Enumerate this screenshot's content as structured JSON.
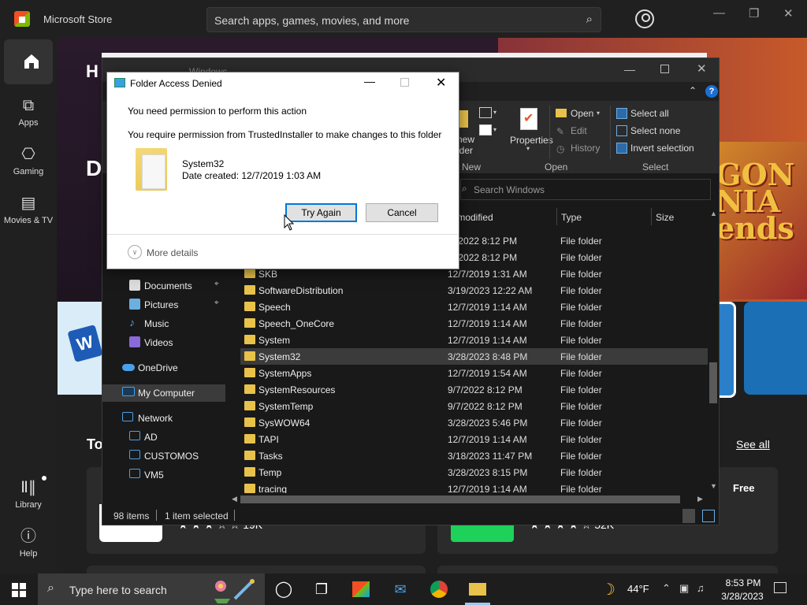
{
  "store": {
    "app_name": "Microsoft Store",
    "search_placeholder": "Search apps, games, movies, and more",
    "rail": [
      {
        "label": "Apps"
      },
      {
        "label": "Gaming"
      },
      {
        "label": "Movies & TV"
      },
      {
        "label": "Library"
      },
      {
        "label": "Help"
      }
    ],
    "hero_heading_partial": "H",
    "hero_sub_partial": "D",
    "game_logo_text": "GON\nNIA\nends",
    "section_partial": "To",
    "see_all": "See all",
    "card1_rating": "★ ★ ★ ☆ ☆  19K",
    "card2_rating": "★ ★ ★ ★ ☆  52K",
    "free_label": "Free",
    "word_tile_letter": "W"
  },
  "explorer": {
    "title": "Windows",
    "ribbon": {
      "new_folder_partial": "new\nlder",
      "properties": "Properties",
      "open": "Open",
      "edit": "Edit",
      "history": "History",
      "select_all": "Select all",
      "select_none": "Select none",
      "invert_selection": "Invert selection",
      "group_new": "New",
      "group_open": "Open",
      "group_select": "Select"
    },
    "search_placeholder": "Search Windows",
    "columns": {
      "date": "te modified",
      "type": "Type",
      "size": "Size"
    },
    "nav": [
      {
        "label": "Documents"
      },
      {
        "label": "Pictures"
      },
      {
        "label": "Music"
      },
      {
        "label": "Videos"
      },
      {
        "label": "OneDrive"
      },
      {
        "label": "My Computer"
      },
      {
        "label": "Network"
      },
      {
        "label": "AD"
      },
      {
        "label": "CUSTOMOS"
      },
      {
        "label": "VM5"
      }
    ],
    "files": [
      {
        "name": "",
        "date": "/7/2022 8:12 PM",
        "type": "File folder"
      },
      {
        "name": "",
        "date": "/7/2022 8:12 PM",
        "type": "File folder"
      },
      {
        "name": "SKB",
        "date": "12/7/2019 1:31 AM",
        "type": "File folder"
      },
      {
        "name": "SoftwareDistribution",
        "date": "3/19/2023 12:22 AM",
        "type": "File folder"
      },
      {
        "name": "Speech",
        "date": "12/7/2019 1:14 AM",
        "type": "File folder"
      },
      {
        "name": "Speech_OneCore",
        "date": "12/7/2019 1:14 AM",
        "type": "File folder"
      },
      {
        "name": "System",
        "date": "12/7/2019 1:14 AM",
        "type": "File folder"
      },
      {
        "name": "System32",
        "date": "3/28/2023 8:48 PM",
        "type": "File folder"
      },
      {
        "name": "SystemApps",
        "date": "12/7/2019 1:54 AM",
        "type": "File folder"
      },
      {
        "name": "SystemResources",
        "date": "9/7/2022 8:12 PM",
        "type": "File folder"
      },
      {
        "name": "SystemTemp",
        "date": "9/7/2022 8:12 PM",
        "type": "File folder"
      },
      {
        "name": "SysWOW64",
        "date": "3/28/2023 5:46 PM",
        "type": "File folder"
      },
      {
        "name": "TAPI",
        "date": "12/7/2019 1:14 AM",
        "type": "File folder"
      },
      {
        "name": "Tasks",
        "date": "3/18/2023 11:47 PM",
        "type": "File folder"
      },
      {
        "name": "Temp",
        "date": "3/28/2023 8:15 PM",
        "type": "File folder"
      },
      {
        "name": "tracing",
        "date": "12/7/2019 1:14 AM",
        "type": "File folder"
      }
    ],
    "status_items": "98 items",
    "status_selected": "1 item selected"
  },
  "dialog": {
    "title": "Folder Access Denied",
    "message1": "You need permission to perform this action",
    "message2": "You require permission from TrustedInstaller to make changes to this folder",
    "folder_name": "System32",
    "folder_date": "Date created: 12/7/2019 1:03 AM",
    "try_again": "Try Again",
    "cancel": "Cancel",
    "more_details": "More details"
  },
  "taskbar": {
    "search_placeholder": "Type here to search",
    "weather_temp": "44°F",
    "time": "8:53 PM",
    "date": "3/28/2023"
  },
  "colors": {
    "accent": "#0078d7",
    "folder": "#e8c24a",
    "selection": "#3b3b3b"
  }
}
